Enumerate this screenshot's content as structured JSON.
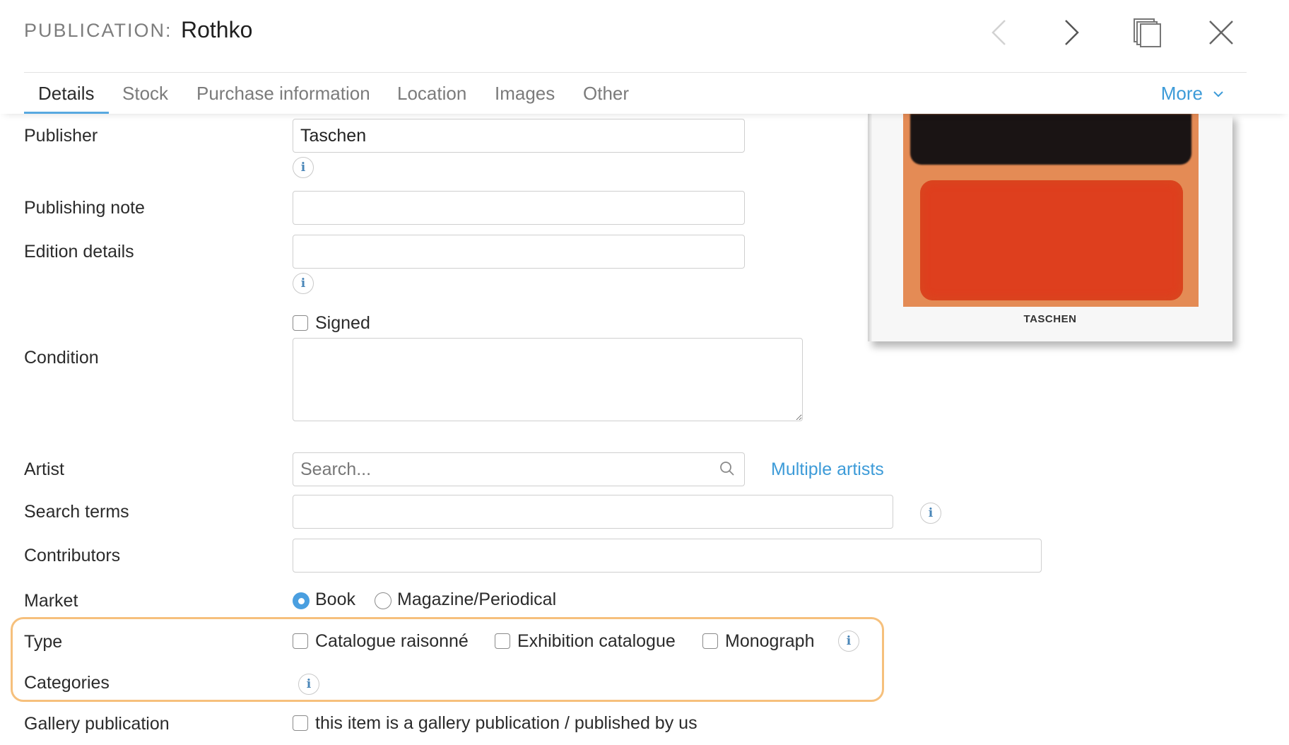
{
  "header": {
    "label": "PUBLICATION:",
    "title": "Rothko"
  },
  "tabs": {
    "details": "Details",
    "stock": "Stock",
    "purchase": "Purchase information",
    "location": "Location",
    "images": "Images",
    "other": "Other",
    "more": "More"
  },
  "form": {
    "publisher": {
      "label": "Publisher",
      "value": "Taschen"
    },
    "publishing_note": {
      "label": "Publishing note",
      "value": ""
    },
    "edition_details": {
      "label": "Edition details",
      "value": ""
    },
    "signed": {
      "label": "Signed",
      "checked": false
    },
    "condition": {
      "label": "Condition",
      "value": ""
    },
    "artist": {
      "label": "Artist",
      "placeholder": "Search...",
      "multiple_link": "Multiple artists"
    },
    "search_terms": {
      "label": "Search terms",
      "value": ""
    },
    "contributors": {
      "label": "Contributors",
      "value": ""
    },
    "market": {
      "label": "Market",
      "options": [
        "Book",
        "Magazine/Periodical"
      ],
      "selected": "Book"
    },
    "type": {
      "label": "Type",
      "options": [
        "Catalogue raisonné",
        "Exhibition catalogue",
        "Monograph"
      ]
    },
    "categories": {
      "label": "Categories"
    },
    "gallery_publication": {
      "label": "Gallery publication",
      "checkbox_text": "this item is a gallery publication / published by us"
    }
  },
  "cover_image": {
    "brand": "TASCHEN"
  },
  "icons": {
    "info": "i",
    "prev": "chevron-left-icon",
    "next": "chevron-right-icon",
    "duplicate": "copy-icon",
    "close": "close-icon",
    "search": "search-icon",
    "more_chevron": "chevron-down-icon"
  },
  "colors": {
    "accent": "#3d9bd8",
    "highlight_border": "#f6c07c",
    "radio_selected": "#4a9fe0"
  }
}
